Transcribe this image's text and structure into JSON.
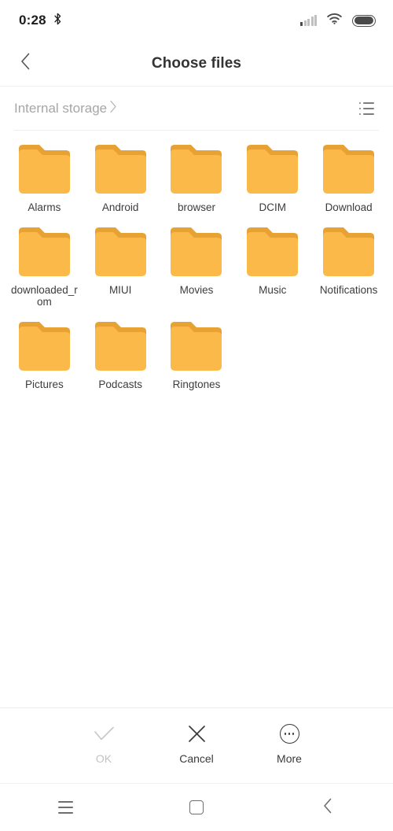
{
  "status_bar": {
    "clock": "0:28",
    "bluetooth_icon": "bluetooth-icon",
    "signal_icon": "signal-bars-icon",
    "wifi_icon": "wifi-icon",
    "battery_icon": "battery-full-icon"
  },
  "header": {
    "back_icon": "back-chevron-icon",
    "title": "Choose files"
  },
  "breadcrumb": {
    "label": "Internal storage",
    "chevron": "›",
    "view_toggle_icon": "list-view-icon"
  },
  "files": {
    "items": [
      {
        "name": "Alarms",
        "type": "folder"
      },
      {
        "name": "Android",
        "type": "folder"
      },
      {
        "name": "browser",
        "type": "folder"
      },
      {
        "name": "DCIM",
        "type": "folder"
      },
      {
        "name": "Download",
        "type": "folder"
      },
      {
        "name": "downloaded_rom",
        "type": "folder"
      },
      {
        "name": "MIUI",
        "type": "folder"
      },
      {
        "name": "Movies",
        "type": "folder"
      },
      {
        "name": "Music",
        "type": "folder"
      },
      {
        "name": "Notifications",
        "type": "folder"
      },
      {
        "name": "Pictures",
        "type": "folder"
      },
      {
        "name": "Podcasts",
        "type": "folder"
      },
      {
        "name": "Ringtones",
        "type": "folder"
      }
    ]
  },
  "action_bar": {
    "ok": {
      "label": "OK",
      "icon": "checkmark-icon",
      "enabled": false
    },
    "cancel": {
      "label": "Cancel",
      "icon": "close-x-icon",
      "enabled": true
    },
    "more": {
      "label": "More",
      "icon": "more-ellipsis-icon",
      "enabled": true
    }
  },
  "nav_bar": {
    "recents_icon": "menu-recents-icon",
    "home_icon": "home-square-icon",
    "back_icon": "back-chevron-icon"
  },
  "colors": {
    "folder_body": "#fab949",
    "folder_tab": "#e8a233",
    "title_text": "#333333",
    "muted_text": "#a6a6a6",
    "disabled_text": "#c2c2c2"
  }
}
